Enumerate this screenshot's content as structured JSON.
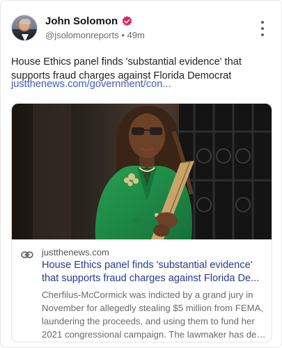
{
  "post": {
    "author_name": "John Solomon",
    "handle": "@jsolomonreports",
    "separator": "•",
    "time": "49m",
    "text": "House Ethics panel finds 'substantial evidence' that supports fraud charges against Florida Democrat",
    "link_text": "justthenews.com/government/con..."
  },
  "card": {
    "domain": "justthenews.com",
    "title_line1": "House Ethics panel finds 'substantial evidence'",
    "title_line2": "that supports fraud charges against Florida De...",
    "desc_line1": "Cherfilus-McCormick was indicted by a grand jury in",
    "desc_line2": "November for allegedly stealing $5 million from FEMA,",
    "desc_line3": "laundering the proceeds, and using them to fund her",
    "desc_line4": "2021 congressional campaign. The lawmaker has deni..."
  },
  "colors": {
    "verified_badge": "#e0245e",
    "link": "#3b58c4",
    "card_title": "#243c8f",
    "jacket_green": "#1e8a43"
  },
  "icons": {
    "verified": "verified-badge-icon",
    "menu": "more-vertical-icon",
    "link": "link-icon"
  }
}
